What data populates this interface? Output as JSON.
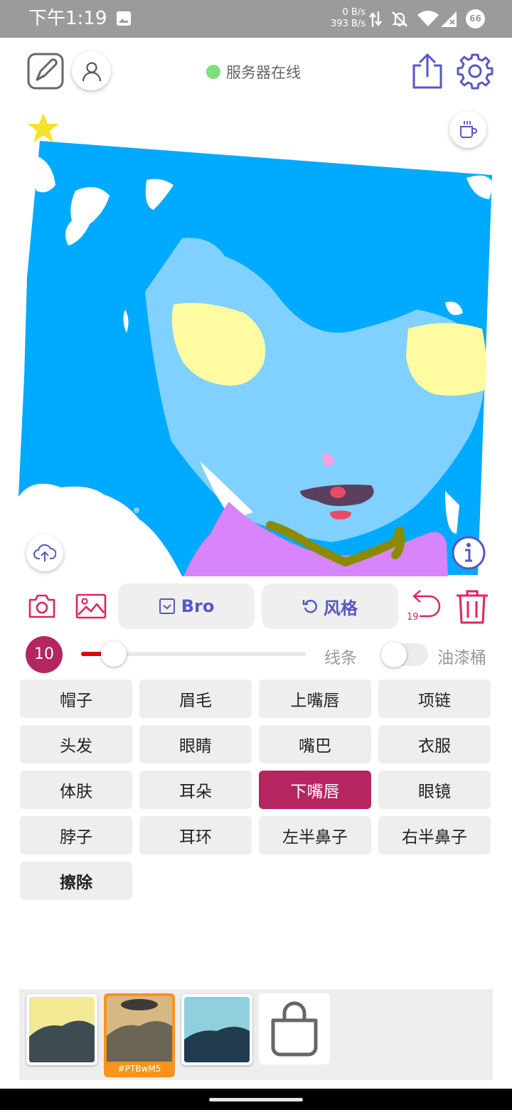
{
  "status_bar": {
    "time": "下午1:19",
    "net_up": "0 B/s",
    "net_down": "393 B/s",
    "battery": "66",
    "icons": [
      "image-icon",
      "data-transfer-icon",
      "bell-off-icon",
      "wifi-icon",
      "signal-icon",
      "battery-icon"
    ]
  },
  "top_bar": {
    "server_status": "服务器在线",
    "server_status_color": "#7ee07a",
    "icons": [
      "edit-canvas-icon",
      "user-icon",
      "share-icon",
      "gear-icon"
    ]
  },
  "canvas": {
    "icons": [
      "star-icon",
      "coffee-cup-icon",
      "cloud-upload-icon",
      "info-icon"
    ],
    "colors": {
      "background": "#00aaff",
      "face": "#80d1ff",
      "cheek": "#fffba0",
      "clothes": "#d884fa",
      "necklace": "#8a8b00",
      "mouth": "#5b3f5e",
      "lip": "#e84b67"
    }
  },
  "tool_row": {
    "bro_label": "Bro",
    "style_label": "风格",
    "undo_count": "19",
    "icons": [
      "camera-icon",
      "gallery-icon",
      "checkbox-icon",
      "refresh-icon",
      "undo-icon",
      "trash-icon"
    ],
    "accent": "#e0245e",
    "primary": "#5557c8"
  },
  "brush": {
    "size": "10",
    "slider_value_percent": 15,
    "mode_line": "线条",
    "mode_bucket": "油漆桶",
    "bucket_enabled": false
  },
  "parts": [
    {
      "label": "帽子",
      "selected": false
    },
    {
      "label": "眉毛",
      "selected": false
    },
    {
      "label": "上嘴唇",
      "selected": false
    },
    {
      "label": "项链",
      "selected": false
    },
    {
      "label": "头发",
      "selected": false
    },
    {
      "label": "眼睛",
      "selected": false
    },
    {
      "label": "嘴巴",
      "selected": false
    },
    {
      "label": "衣服",
      "selected": false
    },
    {
      "label": "体肤",
      "selected": false
    },
    {
      "label": "耳朵",
      "selected": false
    },
    {
      "label": "下嘴唇",
      "selected": true
    },
    {
      "label": "眼镜",
      "selected": false
    },
    {
      "label": "脖子",
      "selected": false
    },
    {
      "label": "耳环",
      "selected": false
    },
    {
      "label": "左半鼻子",
      "selected": false
    },
    {
      "label": "右半鼻子",
      "selected": false
    }
  ],
  "erase_label": "擦除",
  "selected_color": "#b5255f",
  "style_tray": {
    "selected_code": "#PTBwM5",
    "selected_color": "#f7941d",
    "icons": [
      "shopping-bag-icon"
    ]
  }
}
